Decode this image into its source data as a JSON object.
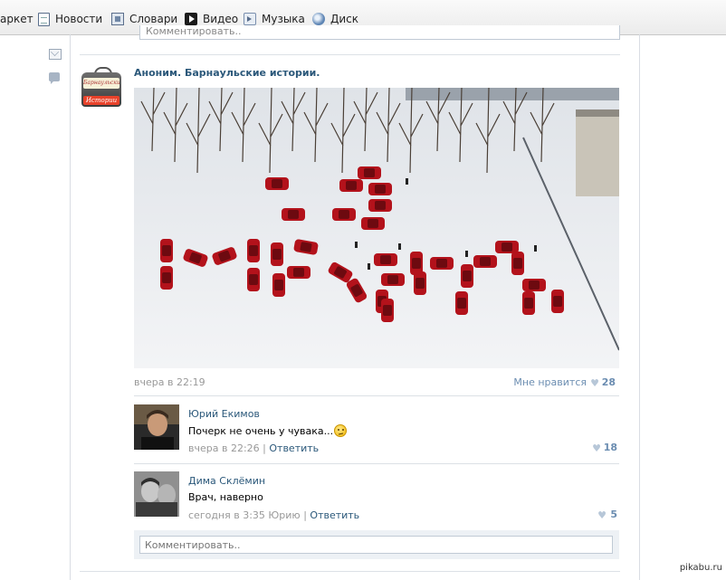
{
  "toolbar": {
    "items": [
      {
        "label": "аркет",
        "icon": "none"
      },
      {
        "label": "Новости",
        "icon": "news-icon"
      },
      {
        "label": "Словари",
        "icon": "dictionary-icon"
      },
      {
        "label": "Видео",
        "icon": "video-icon"
      },
      {
        "label": "Музыка",
        "icon": "music-icon"
      },
      {
        "label": "Диск",
        "icon": "disk-icon"
      }
    ]
  },
  "prev_comment_placeholder": "Комментировать..",
  "post": {
    "group_name": "Аноним. Барнаульские истории.",
    "logo_text_top": "Барнаульские",
    "logo_text_bottom": "Истории",
    "time": "вчера в 22:19",
    "like_label": "Мне нравится",
    "like_count": "28",
    "photo_text": "Я МУРЛЯ"
  },
  "comments": [
    {
      "author": "Юрий Екимов",
      "text": "Почерк не очень у чувака...",
      "time": "вчера в 22:26",
      "separator": "|",
      "reply_label": "Ответить",
      "likes": "18"
    },
    {
      "author": "Дима Склёмин",
      "text": "Врач, наверно",
      "time": "сегодня в 3:35 Юрию",
      "separator": "|",
      "reply_label": "Ответить",
      "likes": "5"
    }
  ],
  "comment_input": {
    "placeholder": "Комментировать.."
  },
  "watermark": "pikabu.ru",
  "colors": {
    "link": "#2b587a",
    "meta": "#999999",
    "accent": "#6b8db1",
    "car_red": "#b3121b"
  }
}
